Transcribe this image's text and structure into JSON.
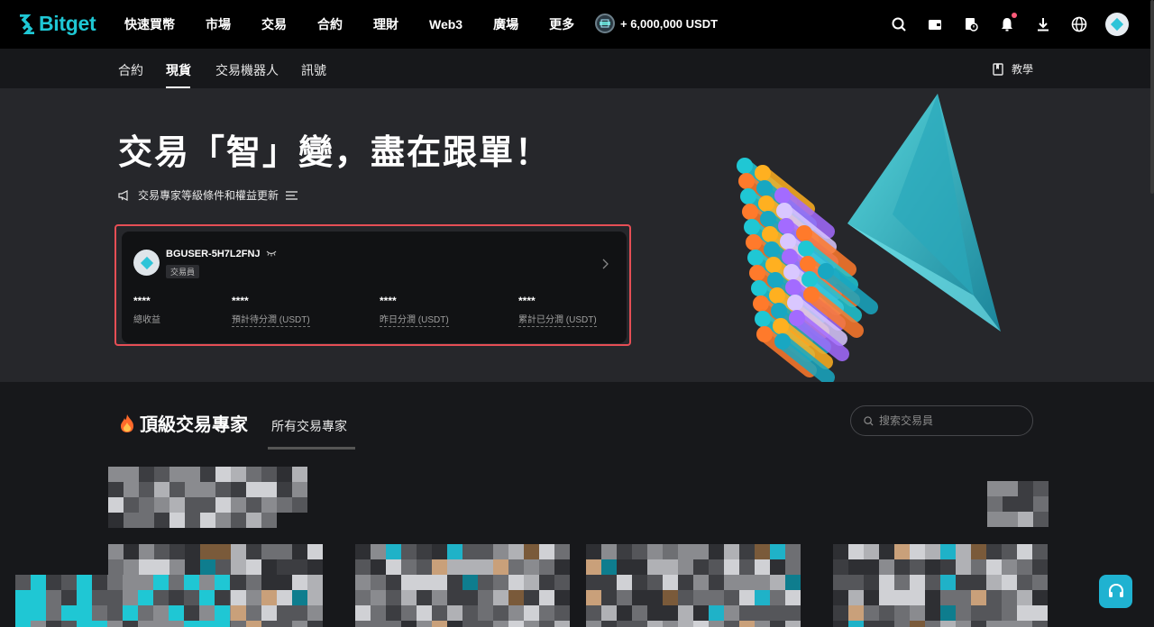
{
  "brand": {
    "name": "Bitget"
  },
  "nav": [
    "快速買幣",
    "市場",
    "交易",
    "合約",
    "理財",
    "Web3",
    "廣場",
    "更多"
  ],
  "promo": {
    "text": "+ 6,000,000 USDT"
  },
  "top_icons": [
    "search-icon",
    "wallet-icon",
    "orders-icon",
    "bell-icon",
    "download-icon",
    "globe-icon"
  ],
  "subnav": {
    "items": [
      "合約",
      "現貨",
      "交易機器人",
      "訊號"
    ],
    "active": "現貨",
    "tutorial": "教學"
  },
  "hero": {
    "title": "交易「智」變，盡在跟單！",
    "notice": "交易專家等級條件和權益更新"
  },
  "trader_card": {
    "username": "BGUSER-5H7L2FNJ",
    "role": "交易員",
    "stats": [
      {
        "value": "****",
        "label": "總收益"
      },
      {
        "value": "****",
        "label": "預計待分潤 (USDT)"
      },
      {
        "value": "****",
        "label": "昨日分潤 (USDT)"
      },
      {
        "value": "****",
        "label": "累計已分潤 (USDT)"
      }
    ]
  },
  "experts": {
    "title": "頂級交易專家",
    "all_link": "所有交易專家",
    "search_placeholder": "搜索交易員"
  },
  "colors": {
    "accent": "#1fc7d4",
    "highlight_border": "#e64e55",
    "support": "#1fb2d1"
  }
}
